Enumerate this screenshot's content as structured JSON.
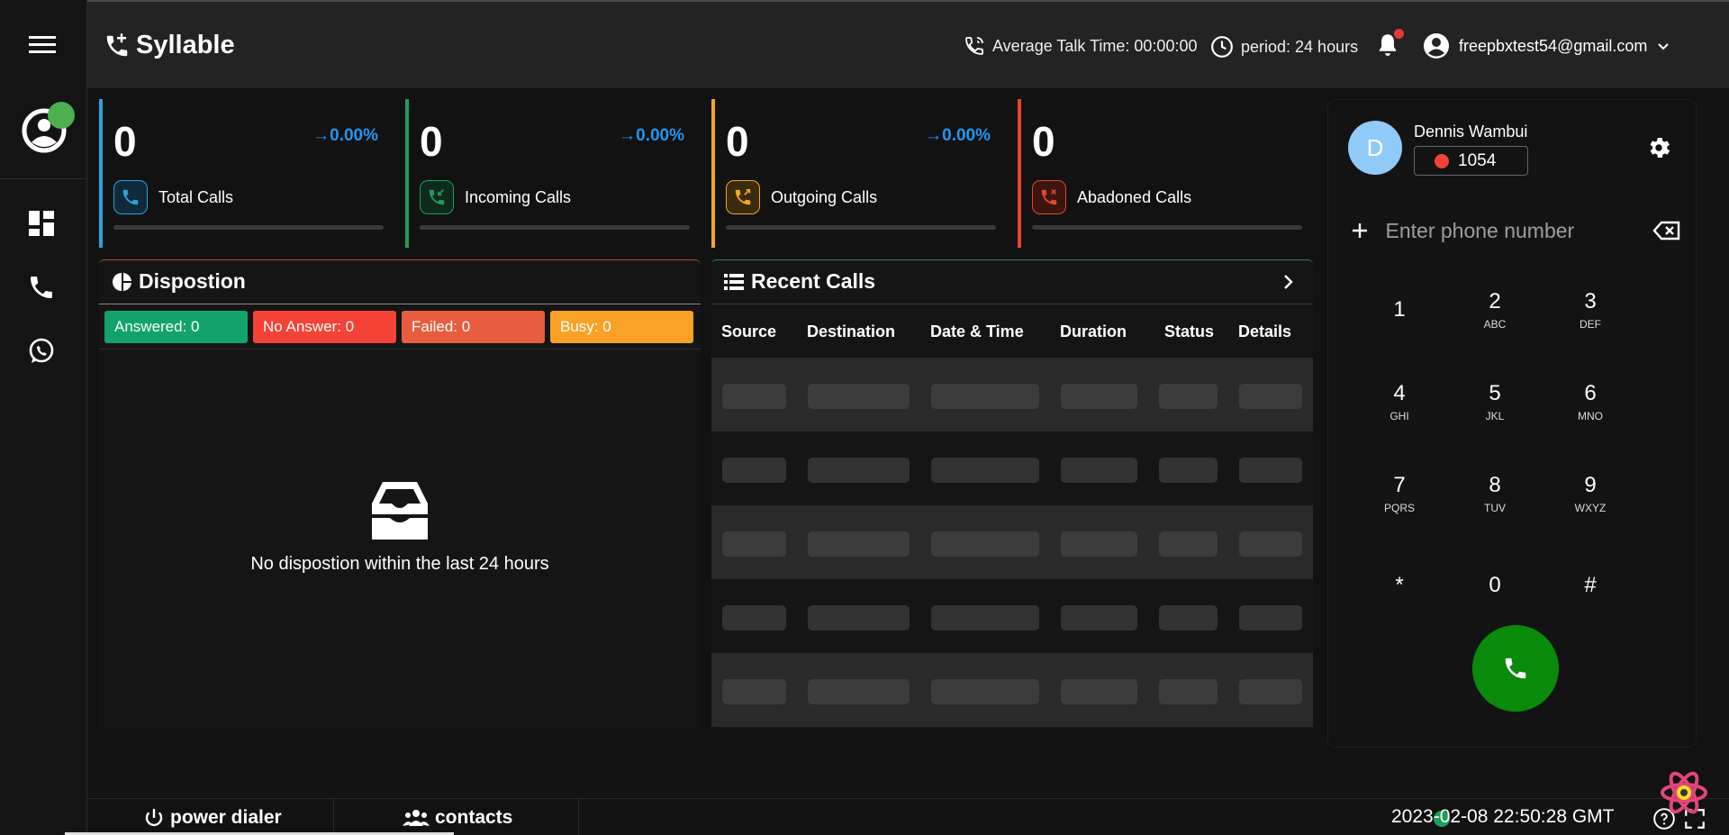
{
  "header": {
    "brand": "Syllable",
    "avg_talk_label": "Average Talk Time: 00:00:00",
    "period_label": "period: 24 hours",
    "user_email": "freepbxtest54@gmail.com"
  },
  "stats": [
    {
      "value": "0",
      "change": "→0.00%",
      "label": "Total Calls",
      "color": "#29a3e0"
    },
    {
      "value": "0",
      "change": "→0.00%",
      "label": "Incoming Calls",
      "color": "#1e9e59"
    },
    {
      "value": "0",
      "change": "→0.00%",
      "label": "Outgoing Calls",
      "color": "#f5a623"
    },
    {
      "value": "0",
      "change": "",
      "label": "Abadoned Calls",
      "color": "#e8452c"
    }
  ],
  "disposition": {
    "title": "Dispostion",
    "chips": [
      {
        "label": "Answered: 0",
        "color": "#12a36b"
      },
      {
        "label": "No Answer: 0",
        "color": "#f44336"
      },
      {
        "label": "Failed: 0",
        "color": "#e85d3f"
      },
      {
        "label": "Busy: 0",
        "color": "#f9a126"
      }
    ],
    "empty_message": "No dispostion within the last 24 hours"
  },
  "recent_calls": {
    "title": "Recent Calls",
    "columns": [
      "Source",
      "Destination",
      "Date & Time",
      "Duration",
      "Status",
      "Details"
    ]
  },
  "dialer": {
    "agent_initial": "D",
    "agent_name": "Dennis Wambui",
    "extension": "1054",
    "phone_placeholder": "Enter phone number",
    "keys": [
      {
        "digit": "1",
        "letters": ""
      },
      {
        "digit": "2",
        "letters": "ABC"
      },
      {
        "digit": "3",
        "letters": "DEF"
      },
      {
        "digit": "4",
        "letters": "GHI"
      },
      {
        "digit": "5",
        "letters": "JKL"
      },
      {
        "digit": "6",
        "letters": "MNO"
      },
      {
        "digit": "7",
        "letters": "PQRS"
      },
      {
        "digit": "8",
        "letters": "TUV"
      },
      {
        "digit": "9",
        "letters": "WXYZ"
      },
      {
        "digit": "*",
        "letters": ""
      },
      {
        "digit": "0",
        "letters": ""
      },
      {
        "digit": "#",
        "letters": ""
      }
    ]
  },
  "footer": {
    "power_dialer_label": "power dialer",
    "contacts_label": "contacts",
    "datetime": "2023-02-08 22:50:28 GMT"
  },
  "icons": {
    "menu": "menu-icon",
    "dashboard": "dashboard-icon",
    "phone": "phone-icon",
    "whatsapp": "whatsapp-icon",
    "bell": "bell-icon",
    "settings": "gear-icon"
  }
}
